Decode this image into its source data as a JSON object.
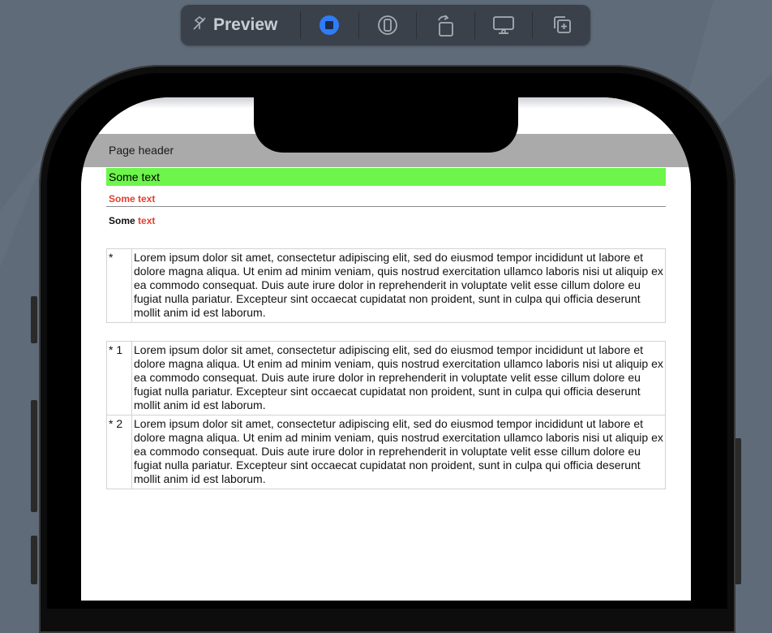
{
  "toolbar": {
    "title": "Preview",
    "buttons": [
      {
        "icon": "live-preview-icon",
        "active": true
      },
      {
        "icon": "device-settings-icon"
      },
      {
        "icon": "rotate-icon"
      },
      {
        "icon": "display-icon"
      },
      {
        "icon": "duplicate-icon"
      }
    ]
  },
  "page": {
    "header": "Page header",
    "green_text": "Some text",
    "red_text": "Some text",
    "mixed": {
      "black": "Some",
      "red": "text"
    },
    "list1": [
      {
        "marker": "*",
        "text": "Lorem ipsum dolor sit amet, consectetur adipiscing elit, sed do eiusmod tempor incididunt ut labore et dolore magna aliqua. Ut enim ad minim veniam, quis nostrud exercitation ullamco laboris nisi ut aliquip ex ea commodo consequat. Duis aute irure dolor in reprehenderit in voluptate velit esse cillum dolore eu fugiat nulla pariatur. Excepteur sint occaecat cupidatat non proident, sunt in culpa qui officia deserunt mollit anim id est laborum."
      }
    ],
    "list2": [
      {
        "marker": "* 1",
        "text": "Lorem ipsum dolor sit amet, consectetur adipiscing elit, sed do eiusmod tempor incididunt ut labore et dolore magna aliqua. Ut enim ad minim veniam, quis nostrud exercitation ullamco laboris nisi ut aliquip ex ea commodo consequat. Duis aute irure dolor in reprehenderit in voluptate velit esse cillum dolore eu fugiat nulla pariatur. Excepteur sint occaecat cupidatat non proident, sunt in culpa qui officia deserunt mollit anim id est laborum."
      },
      {
        "marker": "* 2",
        "text": "Lorem ipsum dolor sit amet, consectetur adipiscing elit, sed do eiusmod tempor incididunt ut labore et dolore magna aliqua. Ut enim ad minim veniam, quis nostrud exercitation ullamco laboris nisi ut aliquip ex ea commodo consequat. Duis aute irure dolor in reprehenderit in voluptate velit esse cillum dolore eu fugiat nulla pariatur. Excepteur sint occaecat cupidatat non proident, sunt in culpa qui officia deserunt mollit anim id est laborum."
      }
    ]
  },
  "colors": {
    "green_highlight": "#6df54b",
    "red_text": "#e53e2e",
    "header_bg": "#aaaaaa",
    "active_blue": "#2f7cf6"
  }
}
